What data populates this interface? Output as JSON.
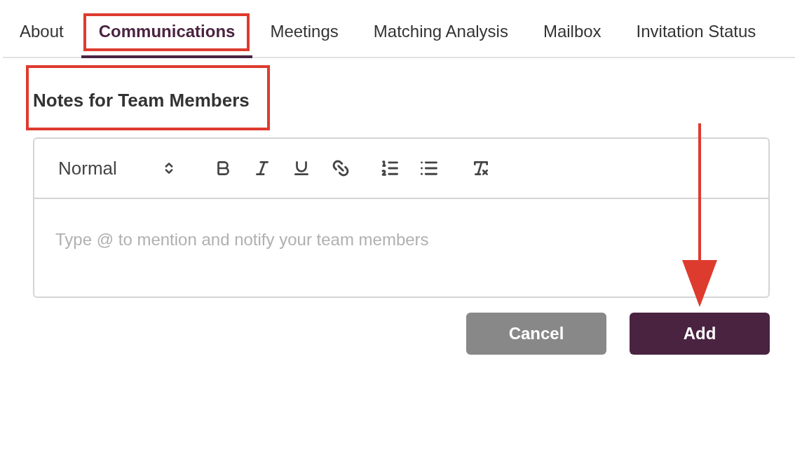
{
  "tabs": [
    {
      "label": "About",
      "selected": false,
      "highlighted": false
    },
    {
      "label": "Communications",
      "selected": true,
      "highlighted": true
    },
    {
      "label": "Meetings",
      "selected": false,
      "highlighted": false
    },
    {
      "label": "Matching Analysis",
      "selected": false,
      "highlighted": false
    },
    {
      "label": "Mailbox",
      "selected": false,
      "highlighted": false
    },
    {
      "label": "Invitation Status",
      "selected": false,
      "highlighted": false
    }
  ],
  "section": {
    "title": "Notes for Team Members",
    "highlighted": true
  },
  "editor": {
    "format_select": "Normal",
    "placeholder": "Type @ to mention and notify your team members"
  },
  "buttons": [
    {
      "label": "Cancel",
      "kind": "secondary"
    },
    {
      "label": "Add",
      "kind": "primary"
    }
  ],
  "annotation": {
    "kind": "arrow"
  }
}
